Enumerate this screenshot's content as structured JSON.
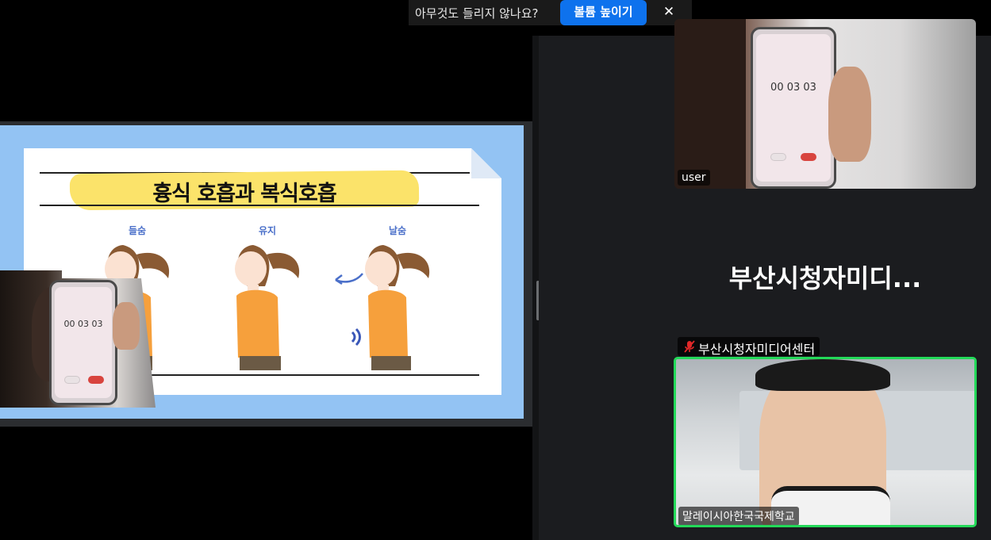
{
  "notice": {
    "message": "아무것도 들리지 않나요?",
    "volume_button": "볼륨 높이기",
    "close_label": "✕"
  },
  "slide": {
    "title": "흉식 호흡과 복식호흡",
    "phases": [
      "들숨",
      "유지",
      "날숨"
    ]
  },
  "pip_phone": {
    "time": "00 03 03"
  },
  "participants": {
    "user_tile": {
      "name": "user",
      "phone_time": "00 03 03"
    },
    "center_tile": {
      "display_name": "부산시청자미디...",
      "full_name": "부산시청자미디어센터",
      "muted": true
    },
    "active_tile": {
      "name": "말레이시아한국국제학교"
    }
  },
  "colors": {
    "accent": "#0e72ed",
    "active_speaker": "#23d959",
    "muted_icon": "#e02828"
  }
}
